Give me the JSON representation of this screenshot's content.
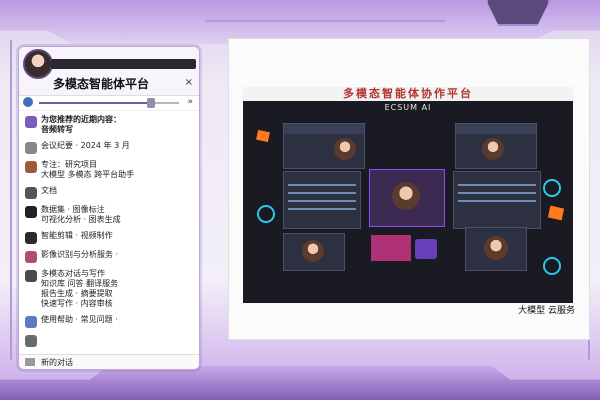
{
  "panel": {
    "title": "多模态智能体平台",
    "close_label": "×",
    "slider": {
      "fill_fraction": 0.8
    },
    "slider_end_label": "»",
    "items": [
      {
        "icon": "chat-bubble-icon",
        "color": "#7b5cb8",
        "text": "为您推荐的近期内容：\n音频转写"
      },
      {
        "icon": "doc-icon",
        "color": "#888888",
        "text": "会议纪要 · 2024 年 3 月"
      },
      {
        "icon": "avatar-icon",
        "color": "#a05a3a",
        "text": "专注：研究项目\n大模型 多模态 跨平台助手"
      },
      {
        "icon": "tag-icon",
        "color": "#555555",
        "text": "文档"
      },
      {
        "icon": "bookmark-icon",
        "color": "#222222",
        "text": "数据集 · 图像标注\n可视化分析 · 图表生成"
      },
      {
        "icon": "image-icon",
        "color": "#2b2b2b",
        "text": "智能剪辑 · 视频制作"
      },
      {
        "icon": "photo-icon",
        "color": "#b14b7a",
        "text": "影像识别与分析服务 ·"
      },
      {
        "icon": "chat-icon",
        "color": "#4b4b4b",
        "text": "多模态对话与写作\n知识库 问答 翻译服务\n报告生成 · 摘要提取\n快速写作 · 内容审核"
      },
      {
        "icon": "help-icon",
        "color": "#5a7ac4",
        "text": "使用帮助 · 常见问题 ·"
      },
      {
        "icon": "settings-icon",
        "color": "#6b6b6b",
        "text": ""
      }
    ],
    "footer_text": "新的对话"
  },
  "content": {
    "banner_text": "多模态智能体协作平台",
    "sub_text": "ECSUM AI",
    "caption": "大模型 云服务"
  },
  "colors": {
    "accent": "#8a63c9",
    "frame": "#b69ad7",
    "banner_red": "#b2352e"
  }
}
